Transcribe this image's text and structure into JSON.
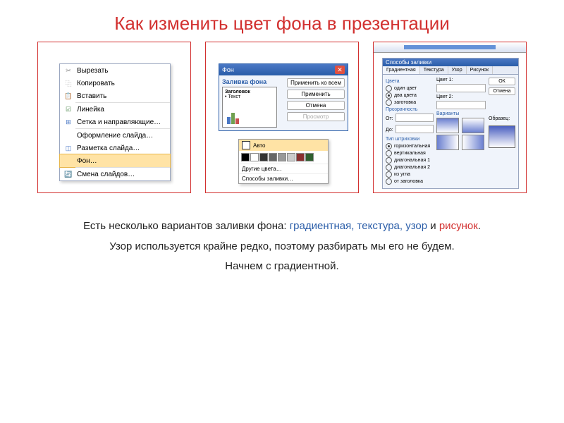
{
  "title": "Как изменить цвет фона в презентации",
  "panel1": {
    "items": [
      {
        "icon": "✂",
        "iconColor": "#888",
        "label": "Вырезать"
      },
      {
        "icon": "⿻",
        "iconColor": "#888",
        "label": "Копировать"
      },
      {
        "icon": "📋",
        "iconColor": "#c78a40",
        "label": "Вставить"
      },
      {
        "icon": "☑",
        "iconColor": "#3a7a3a",
        "label": "Линейка",
        "highlight": false,
        "sepBefore": true
      },
      {
        "icon": "⊞",
        "iconColor": "#4a78c5",
        "label": "Сетка и направляющие…"
      },
      {
        "icon": "",
        "iconColor": "",
        "label": "Оформление слайда…",
        "sepBefore": true
      },
      {
        "icon": "◫",
        "iconColor": "#4a78c5",
        "label": "Разметка слайда…"
      },
      {
        "icon": "",
        "iconColor": "",
        "label": "Фон…",
        "highlight": true
      },
      {
        "icon": "🔄",
        "iconColor": "#4a78c5",
        "label": "Смена слайдов…",
        "sepBefore": true
      }
    ]
  },
  "panel2": {
    "dialogTitle": "Фон",
    "sectionLabel": "Заливка фона",
    "previewTitle": "Заголовок",
    "previewText": "• Текст",
    "buttons": {
      "applyAll": "Применить ко всем",
      "apply": "Применить",
      "cancel": "Отмена",
      "preview": "Просмотр"
    },
    "popup": {
      "auto": "Авто",
      "moreColors": "Другие цвета…",
      "fillMethods": "Способы заливки…",
      "swatches": [
        "#000",
        "#fff",
        "#333",
        "#666",
        "#999",
        "#ccc",
        "#8a3030",
        "#306030"
      ]
    }
  },
  "panel3": {
    "dialogTitle": "Способы заливки",
    "tabs": [
      "Градиентная",
      "Текстура",
      "Узор",
      "Рисунок"
    ],
    "activeTab": 0,
    "colorsGroup": "Цвета",
    "colorOptions": [
      "один цвет",
      "два цвета",
      "заготовка"
    ],
    "color1Label": "Цвет 1:",
    "color2Label": "Цвет 2:",
    "transparencyGroup": "Прозрачность",
    "from": "От:",
    "to": "До:",
    "typeGroup": "Тип штриховки",
    "typeOptions": [
      "горизонтальная",
      "вертикальная",
      "диагональная 1",
      "диагональная 2",
      "из угла",
      "от заголовка"
    ],
    "variantsLabel": "Варианты",
    "sampleLabel": "Образец:",
    "ok": "ОК",
    "cancel": "Отмена"
  },
  "bodyText": {
    "line1_a": "Есть несколько вариантов заливки фона: ",
    "line1_b": "градиентная, текстура, узор",
    "line1_c": " и ",
    "line1_d": "рисунок",
    "line1_e": ".",
    "line2": "Узор используется крайне редко, поэтому разбирать мы его не будем.",
    "line3": "Начнем с градиентной."
  }
}
